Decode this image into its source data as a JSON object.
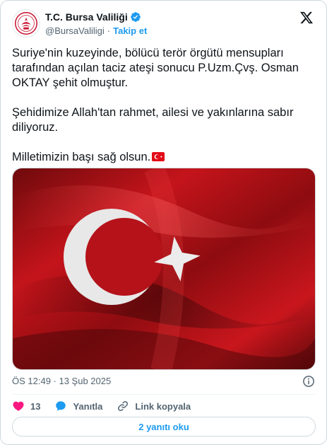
{
  "account": {
    "display_name": "T.C. Bursa Valiliği",
    "handle": "@BursaValiligi",
    "separator": "·",
    "follow_label": "Takip et",
    "verified_color": "#1d9bf0"
  },
  "tweet": {
    "paragraphs": [
      "Suriye'nin kuzeyinde, bölücü terör örgütü mensupları tarafından açılan taciz ateşi sonucu P.Uzm.Çvş. Osman OKTAY şehit olmuştur.",
      "Şehidimize Allah'tan rahmet, ailesi ve yakınlarına sabır diliyoruz.",
      "Milletimizin başı sağ olsun."
    ],
    "media_description_icon": "turkish-flag-image",
    "timestamp": "ÖS 12:49 · 13 Şub 2025"
  },
  "actions": {
    "like_count": "13",
    "reply_label": "Yanıtla",
    "copy_link_label": "Link kopyala"
  },
  "replies_button": {
    "label": "2 yanıtı oku"
  },
  "colors": {
    "accent": "#1d9bf0",
    "like": "#f91880",
    "flag_red": "#e30a17"
  }
}
